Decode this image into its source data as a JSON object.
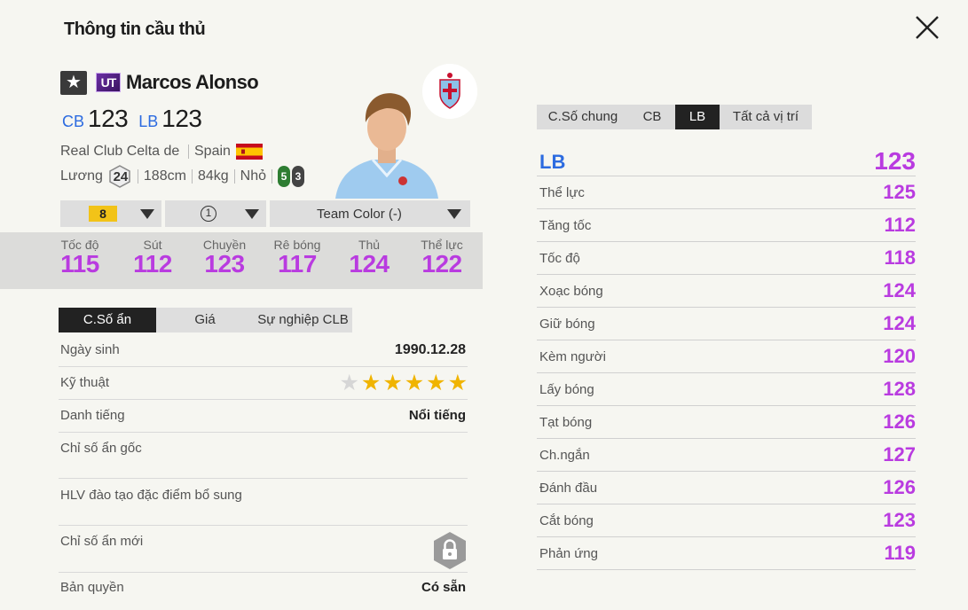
{
  "header": {
    "title": "Thông tin cầu thủ"
  },
  "player": {
    "season_star": "★",
    "season_code": "UT",
    "name": "Marcos Alonso",
    "positions": [
      {
        "abbr": "CB",
        "ovr": "123"
      },
      {
        "abbr": "LB",
        "ovr": "123"
      }
    ],
    "club": "Real Club Celta de Vigo",
    "nation": "Spain",
    "wage_label": "Lương",
    "wage": "24",
    "height": "188cm",
    "weight": "84kg",
    "body": "Nhỏ",
    "left_foot": "5",
    "right_foot": "3"
  },
  "selectors": {
    "level": "8",
    "team_score": "1",
    "team_color": "Team Color (-)"
  },
  "main_stats": [
    {
      "label": "Tốc độ",
      "value": "115"
    },
    {
      "label": "Sút",
      "value": "112"
    },
    {
      "label": "Chuyền",
      "value": "123"
    },
    {
      "label": "Rê bóng",
      "value": "117"
    },
    {
      "label": "Thủ",
      "value": "124"
    },
    {
      "label": "Thể lực",
      "value": "122"
    }
  ],
  "left_tabs": [
    "C.Số ẩn",
    "Giá",
    "Sự nghiệp CLB"
  ],
  "details": {
    "birth_label": "Ngày sinh",
    "birth_value": "1990.12.28",
    "skill_label": "Kỹ thuật",
    "skill_stars": 5,
    "fame_label": "Danh tiếng",
    "fame_value": "Nổi tiếng",
    "hidden_orig_label": "Chỉ số ẩn gốc",
    "coach_label": "HLV đào tạo đặc điểm bổ sung",
    "hidden_new_label": "Chỉ số ẩn mới",
    "license_label": "Bản quyền",
    "license_value": "Có sẵn"
  },
  "right_tabs": [
    "C.Số chung",
    "CB",
    "LB",
    "Tất cả vị trí"
  ],
  "position_stats": {
    "position": "LB",
    "ovr": "123",
    "rows": [
      {
        "label": "Thể lực",
        "value": "125"
      },
      {
        "label": "Tăng tốc",
        "value": "112"
      },
      {
        "label": "Tốc độ",
        "value": "118"
      },
      {
        "label": "Xoạc bóng",
        "value": "124"
      },
      {
        "label": "Giữ bóng",
        "value": "124"
      },
      {
        "label": "Kèm người",
        "value": "120"
      },
      {
        "label": "Lấy bóng",
        "value": "128"
      },
      {
        "label": "Tạt bóng",
        "value": "126"
      },
      {
        "label": "Ch.ngắn",
        "value": "127"
      },
      {
        "label": "Đánh đầu",
        "value": "126"
      },
      {
        "label": "Cắt bóng",
        "value": "123"
      },
      {
        "label": "Phản ứng",
        "value": "119"
      }
    ]
  },
  "colors": {
    "stat_value": "#b93be0",
    "position_blue": "#2c6be0",
    "level_gold": "#f2c318",
    "star_gold": "#f0b400"
  }
}
